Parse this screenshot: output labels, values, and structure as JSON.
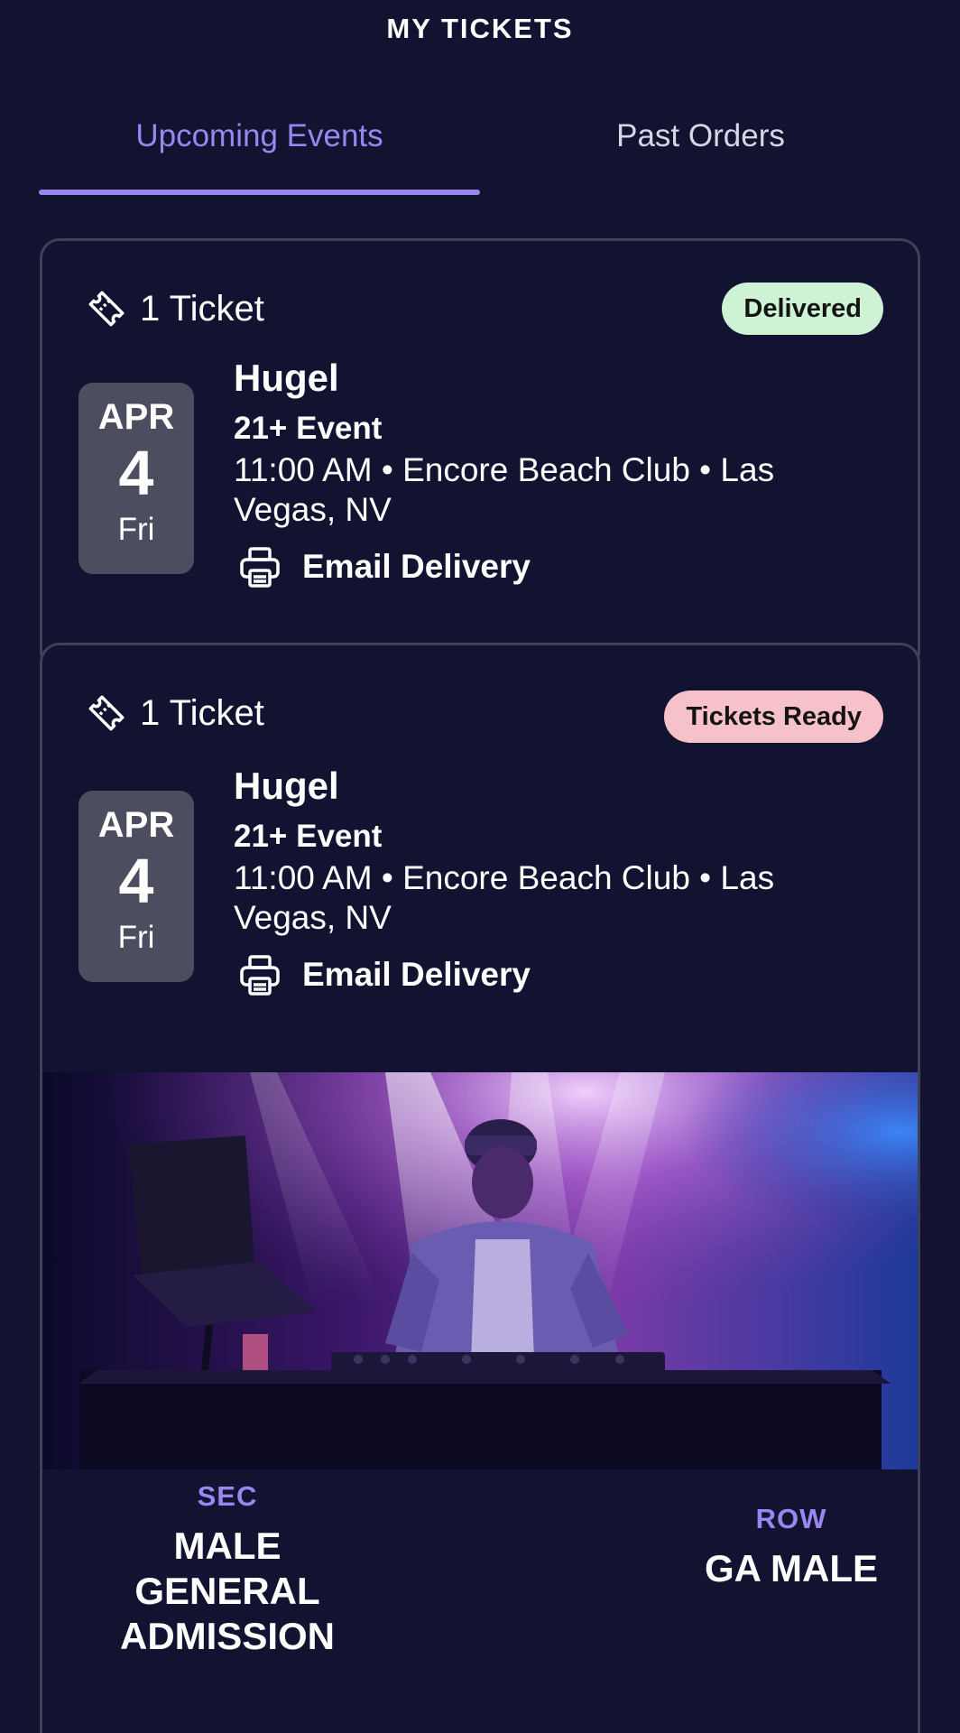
{
  "header": {
    "title": "MY TICKETS"
  },
  "tabs": [
    {
      "label": "Upcoming Events",
      "active": true
    },
    {
      "label": "Past Orders",
      "active": false
    }
  ],
  "tickets": [
    {
      "count": "1 Ticket",
      "status": "Delivered",
      "status_color": "#cdf2d4",
      "date": {
        "month": "APR",
        "day": "4",
        "weekday": "Fri"
      },
      "event_name": "Hugel",
      "age_restriction": "21+ Event",
      "details": "11:00 AM • Encore Beach Club • Las Vegas, NV",
      "delivery": "Email Delivery"
    },
    {
      "count": "1 Ticket",
      "status": "Tickets Ready",
      "status_color": "#f6c1c8",
      "date": {
        "month": "APR",
        "day": "4",
        "weekday": "Fri"
      },
      "event_name": "Hugel",
      "age_restriction": "21+ Event",
      "details": "11:00 AM • Encore Beach Club • Las Vegas, NV",
      "delivery": "Email Delivery",
      "seating": {
        "sec_label": "SEC",
        "sec_value": "MALE GENERAL ADMISSION",
        "row_label": "ROW",
        "row_value": "GA MALE"
      }
    }
  ],
  "colors": {
    "background": "#121331",
    "accent": "#9a86f0",
    "date_box": "#4c4e60"
  },
  "icons": [
    "ticket-icon",
    "printer-icon"
  ]
}
